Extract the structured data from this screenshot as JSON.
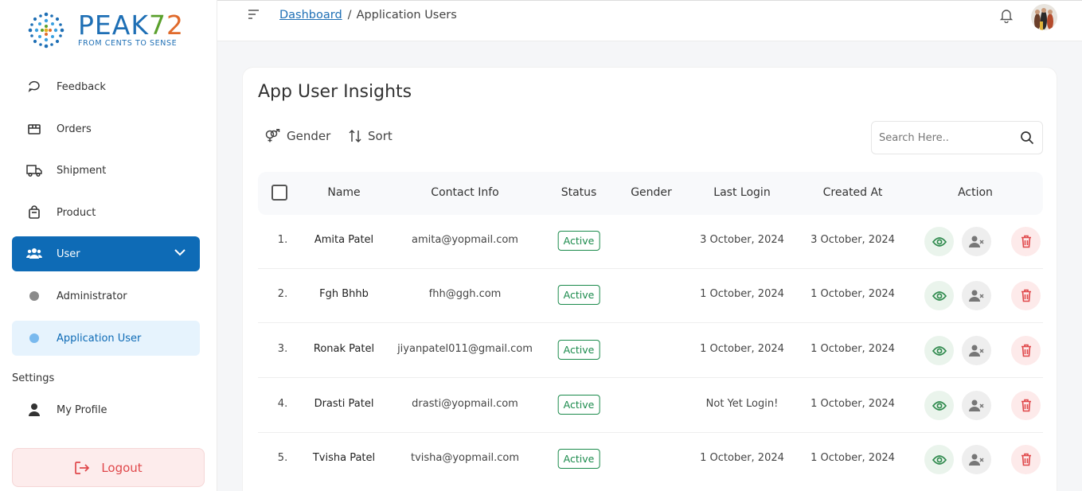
{
  "brand": {
    "name_main": "PEAK",
    "name_7": "7",
    "name_2": "2",
    "tagline": "FROM CENTS TO SENSE"
  },
  "sidebar": {
    "items": [
      {
        "label": "Feedback",
        "icon": "chat-bubble-icon"
      },
      {
        "label": "Orders",
        "icon": "box-icon"
      },
      {
        "label": "Shipment",
        "icon": "truck-icon"
      },
      {
        "label": "Product",
        "icon": "bag-icon"
      },
      {
        "label": "User",
        "icon": "users-icon",
        "expanded": true
      },
      {
        "label": "Administrator",
        "icon": "dot"
      },
      {
        "label": "Application User",
        "icon": "dot",
        "selected": true
      }
    ],
    "settings_label": "Settings",
    "my_profile": "My Profile",
    "logout": "Logout"
  },
  "topbar": {
    "breadcrumb_link": "Dashboard",
    "breadcrumb_sep": "/",
    "breadcrumb_current": "Application Users"
  },
  "main": {
    "title": "App User Insights",
    "gender_filter": "Gender",
    "sort": "Sort",
    "search_placeholder": "Search Here.."
  },
  "table": {
    "headers": [
      "Name",
      "Contact Info",
      "Status",
      "Gender",
      "Last Login",
      "Created At",
      "Action"
    ],
    "rows": [
      {
        "index": "1.",
        "name": "Amita Patel",
        "contact": "amita@yopmail.com",
        "status": "Active",
        "gender": "",
        "last_login": "3 October, 2024",
        "created_at": "3 October, 2024"
      },
      {
        "index": "2.",
        "name": "Fgh Bhhb",
        "contact": "fhh@ggh.com",
        "status": "Active",
        "gender": "",
        "last_login": "1 October, 2024",
        "created_at": "1 October, 2024"
      },
      {
        "index": "3.",
        "name": "Ronak Patel",
        "contact": "jiyanpatel011@gmail.com",
        "status": "Active",
        "gender": "",
        "last_login": "1 October, 2024",
        "created_at": "1 October, 2024"
      },
      {
        "index": "4.",
        "name": "Drasti Patel",
        "contact": "drasti@yopmail.com",
        "status": "Active",
        "gender": "",
        "last_login": "Not Yet Login!",
        "created_at": "1 October, 2024"
      },
      {
        "index": "5.",
        "name": "Tvisha Patel",
        "contact": "tvisha@yopmail.com",
        "status": "Active",
        "gender": "",
        "last_login": "1 October, 2024",
        "created_at": "1 October, 2024"
      }
    ]
  },
  "colors": {
    "primary": "#0e6bb6",
    "active_status": "#1a8a4b",
    "danger": "#e0484b",
    "view_icon": "#2f8a4d"
  }
}
